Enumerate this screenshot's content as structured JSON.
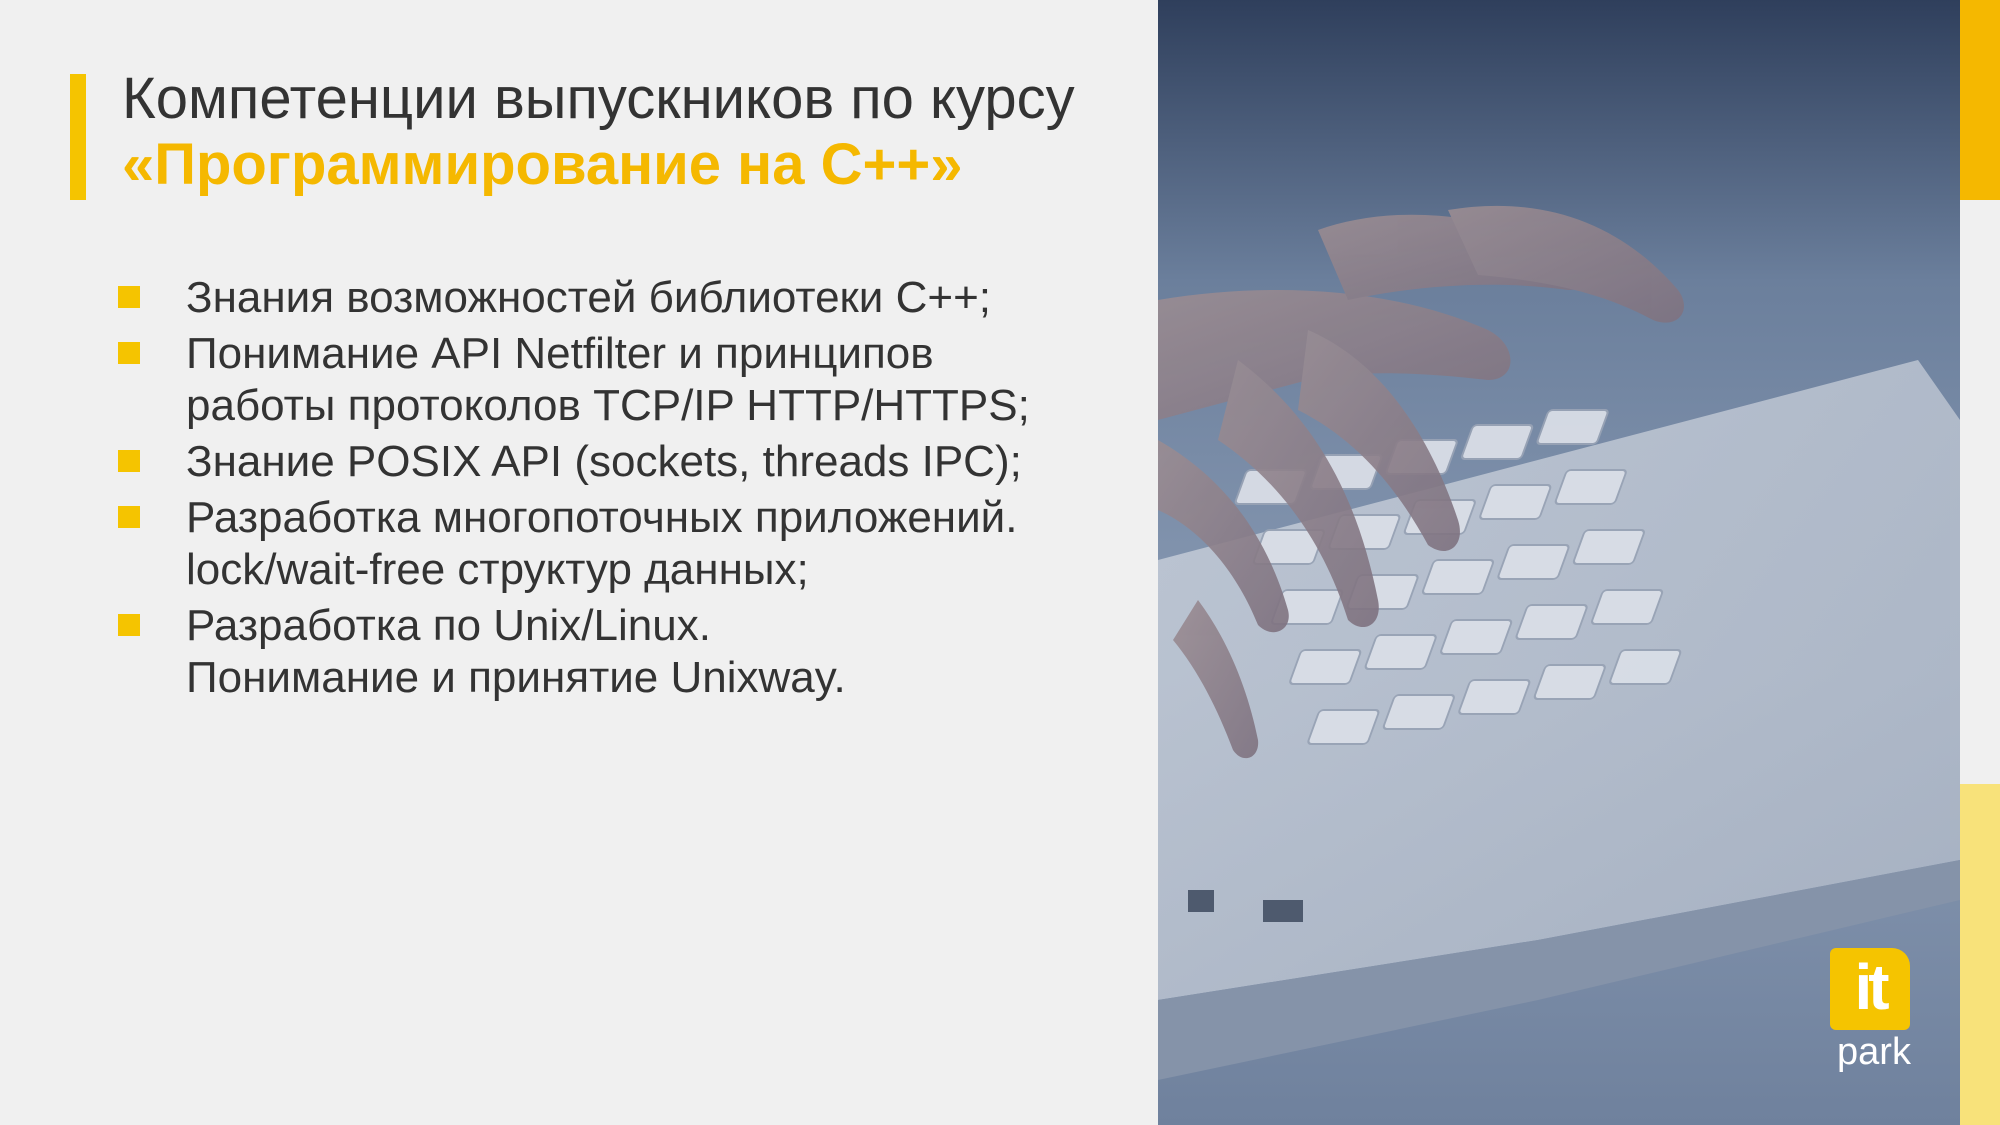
{
  "title": {
    "line1": "Компетенции выпускников по курсу",
    "line2": "«Программирование на С++»"
  },
  "bullets": [
    {
      "lines": [
        "Знания возможностей библиотеки С++;"
      ]
    },
    {
      "lines": [
        "Понимание API Netfilter и принципов",
        "работы протоколов TCP/IP HTTP/HTTPS;"
      ]
    },
    {
      "lines": [
        "Знание POSIX API (sockets, threads IPC);"
      ]
    },
    {
      "lines": [
        "Разработка многопоточных приложений.",
        "lock/wait-free структур данных;"
      ]
    },
    {
      "lines": [
        "Разработка по Unix/Linux.",
        "Понимание и принятие Unixway."
      ]
    }
  ],
  "logo": {
    "badge": "it",
    "word": "park"
  },
  "colors": {
    "accent": "#f5c400",
    "accent_dark": "#f5b800",
    "text": "#333333",
    "background": "#f0f0f0",
    "photo_tint": "#5d6f8c"
  },
  "icons": {
    "bullet": "square-bullet-icon",
    "photo": "keyboard-typing-photo"
  }
}
